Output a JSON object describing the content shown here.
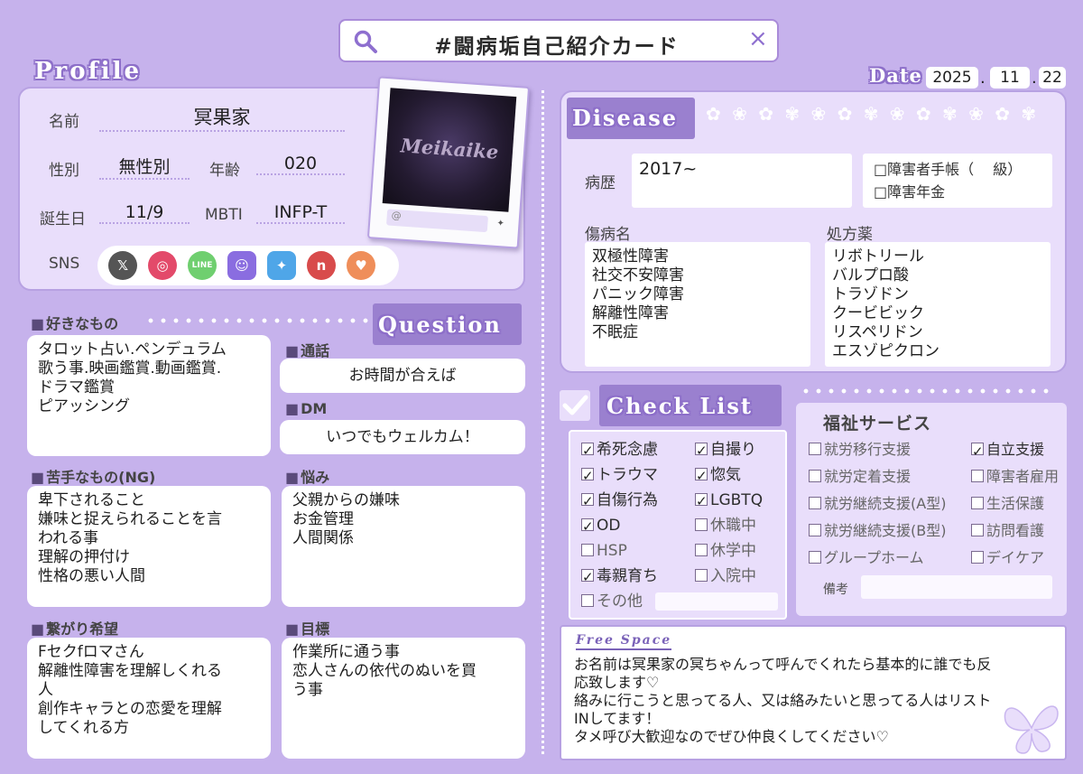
{
  "search": {
    "title": "#闘病垢自己紹介カード",
    "close": "×"
  },
  "date": {
    "label": "Date",
    "year": "2025",
    "month": "11",
    "day": "22",
    "sep": "."
  },
  "profile": {
    "heading": "Profile",
    "name_label": "名前",
    "name": "冥果家",
    "gender_label": "性別",
    "gender": "無性別",
    "age_label": "年齢",
    "age": "020",
    "birthday_label": "誕生日",
    "birthday": "11/9",
    "mbti_label": "MBTI",
    "mbti": "INFP-T",
    "sns_label": "SNS",
    "sns_icons": [
      "x-icon",
      "instagram-icon",
      "line-icon",
      "discord-icon",
      "bluesky-icon",
      "niconico-icon",
      "heart-app-icon"
    ],
    "photo_logo": "Meikaike",
    "photo_handle": "@"
  },
  "question": {
    "heading": "Question",
    "likes": {
      "label": "好きなもの",
      "text": "タロット占い.ペンデュラム\n歌う事.映画鑑賞.動画鑑賞.\nドラマ鑑賞\nピアッシング"
    },
    "dislikes": {
      "label": "苦手なもの(NG)",
      "text": "卑下されること\n嫌味と捉えられることを言\nわれる事\n理解の押付け\n性格の悪い人間"
    },
    "connect": {
      "label": "繋がり希望",
      "text": "Fセクfロマさん\n解離性障害を理解しくれる\n人\n創作キャラとの恋愛を理解\nしてくれる方"
    },
    "call": {
      "label": "通話",
      "text": "お時間が合えば"
    },
    "dm": {
      "label": "DM",
      "text": "いつでもウェルカム！"
    },
    "worries": {
      "label": "悩み",
      "text": "父親からの嫌味\nお金管理\n人間関係"
    },
    "goals": {
      "label": "目標",
      "text": "作業所に通う事\n恋人さんの依代のぬいを買\nう事"
    }
  },
  "disease": {
    "heading": "Disease",
    "history_label": "病歴",
    "history": "2017~",
    "cert_label": "□障害者手帳（　 級）",
    "pension_label": "□障害年金",
    "diagnosis_label": "傷病名",
    "diagnosis": "双極性障害\n社交不安障害\nパニック障害\n解離性障害\n不眠症",
    "meds_label": "処方薬",
    "meds": "リボトリール\nバルプロ酸\nトラゾドン\nクービビック\nリスペリドン\nエスゾピクロン"
  },
  "checklist": {
    "heading": "Check List",
    "left": [
      {
        "label": "希死念慮",
        "checked": true
      },
      {
        "label": "トラウマ",
        "checked": true
      },
      {
        "label": "自傷行為",
        "checked": true
      },
      {
        "label": "OD",
        "checked": true
      },
      {
        "label": "HSP",
        "checked": false
      },
      {
        "label": "毒親育ち",
        "checked": true
      },
      {
        "label": "その他",
        "checked": false
      }
    ],
    "right": [
      {
        "label": "自撮り",
        "checked": true
      },
      {
        "label": "惚気",
        "checked": true
      },
      {
        "label": "LGBTQ",
        "checked": true
      },
      {
        "label": "休職中",
        "checked": false
      },
      {
        "label": "休学中",
        "checked": false
      },
      {
        "label": "入院中",
        "checked": false
      }
    ]
  },
  "welfare": {
    "heading": "福祉サービス",
    "left": [
      {
        "label": "就労移行支援",
        "checked": false
      },
      {
        "label": "就労定着支援",
        "checked": false
      },
      {
        "label": "就労継続支援(A型)",
        "checked": false
      },
      {
        "label": "就労継続支援(B型)",
        "checked": false
      },
      {
        "label": "グループホーム",
        "checked": false
      }
    ],
    "right": [
      {
        "label": "自立支援",
        "checked": true
      },
      {
        "label": "障害者雇用",
        "checked": false
      },
      {
        "label": "生活保護",
        "checked": false
      },
      {
        "label": "訪問看護",
        "checked": false
      },
      {
        "label": "デイケア",
        "checked": false
      }
    ],
    "notes_label": "備考"
  },
  "freespace": {
    "heading": "Free Space",
    "text": "お名前は冥果家の冥ちゃんって呼んでくれたら基本的に誰でも反\n応致します♡\n絡みに行こうと思ってる人、又は絡みたいと思ってる人はリスト\nINしてます！\nタメ呼び大歓迎なのでぜひ仲良くしてください♡"
  }
}
